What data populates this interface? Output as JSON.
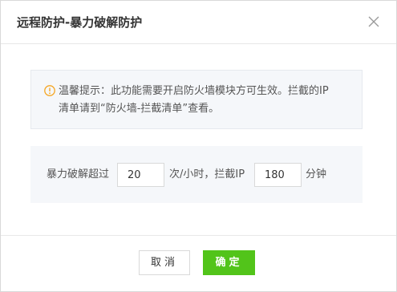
{
  "dialog": {
    "title": "远程防护-暴力破解防护"
  },
  "tip": {
    "line1": "温馨提示：此功能需要开启防火墙模块方可生效。拦截的IP",
    "line2": "清单请到“防火墙-拦截清单”查看。"
  },
  "setting": {
    "prefix": "暴力破解超过",
    "attempts_value": "20",
    "middle": "次/小时，拦截IP",
    "block_minutes_value": "180",
    "suffix": "分钟"
  },
  "footer": {
    "cancel_label": "取消",
    "ok_label": "确定"
  },
  "colors": {
    "accent": "#52c41a",
    "warning": "#f5a623"
  },
  "icons": {
    "close": "close-icon",
    "tip": "info-circle-icon"
  }
}
